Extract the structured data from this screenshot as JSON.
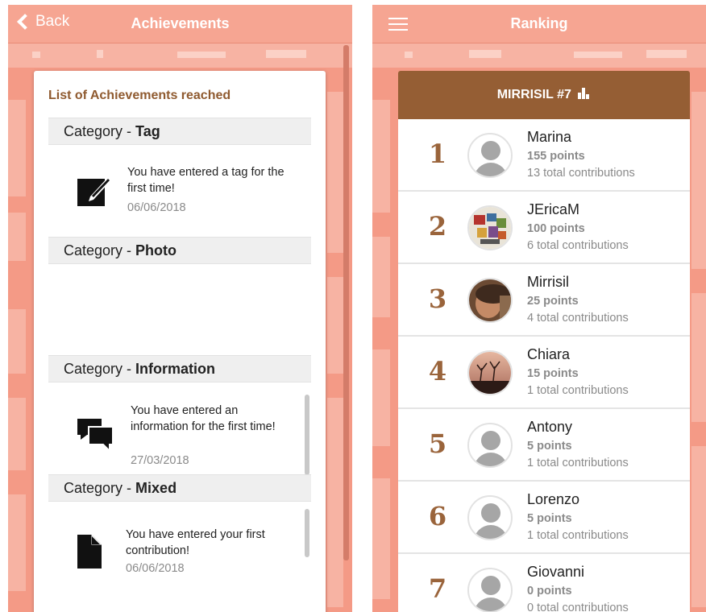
{
  "left": {
    "header": {
      "back_label": "Back",
      "title": "Achievements"
    },
    "card_title": "List of Achievements reached",
    "categories": [
      {
        "prefix": "Category - ",
        "name": "Tag",
        "achievement": {
          "icon": "edit-icon",
          "text": "You have entered a tag for the first time!",
          "date": "06/06/2018"
        }
      },
      {
        "prefix": "Category - ",
        "name": "Photo"
      },
      {
        "prefix": "Category - ",
        "name": "Information",
        "achievement": {
          "icon": "chat-icon",
          "text": "You have entered an information for the first time!",
          "date": "27/03/2018"
        }
      },
      {
        "prefix": "Category - ",
        "name": "Mixed",
        "achievement": {
          "icon": "document-icon",
          "text": "You have entered your first contribution!",
          "date": "06/06/2018"
        }
      }
    ]
  },
  "right": {
    "header": {
      "title": "Ranking",
      "menu_icon": "hamburger-menu-icon"
    },
    "ranking_title": "MIRRISIL #7",
    "ranking_icon": "bar-chart-icon",
    "rows": [
      {
        "rank": "1",
        "name": "Marina",
        "points": "155 points",
        "contributions": "13 total contributions",
        "avatar": "default"
      },
      {
        "rank": "2",
        "name": "JEricaM",
        "points": "100 points",
        "contributions": "6 total contributions",
        "avatar": "photo-collage"
      },
      {
        "rank": "3",
        "name": "Mirrisil",
        "points": "25 points",
        "contributions": "4 total contributions",
        "avatar": "photo-portrait"
      },
      {
        "rank": "4",
        "name": "Chiara",
        "points": "15 points",
        "contributions": "1 total contributions",
        "avatar": "photo-sunset"
      },
      {
        "rank": "5",
        "name": "Antony",
        "points": "5 points",
        "contributions": "1 total contributions",
        "avatar": "default"
      },
      {
        "rank": "6",
        "name": "Lorenzo",
        "points": "5 points",
        "contributions": "1 total contributions",
        "avatar": "default"
      },
      {
        "rank": "7",
        "name": "Giovanni",
        "points": "0 points",
        "contributions": "0 total contributions",
        "avatar": "default"
      }
    ]
  },
  "colors": {
    "app_bar": "#f6a592",
    "background": "#f49a86",
    "accent_brown": "#955e34",
    "title_brown": "#8f5a2f"
  }
}
